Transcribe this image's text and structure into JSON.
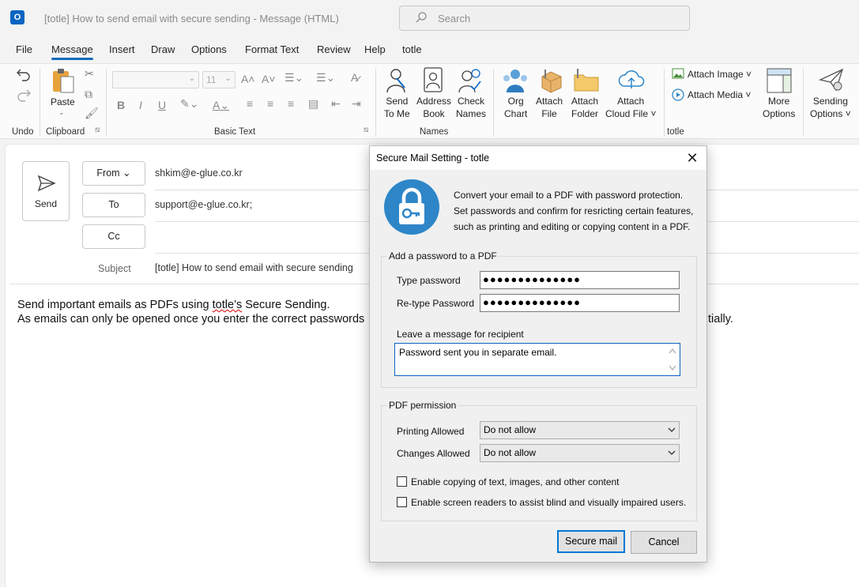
{
  "window": {
    "app_icon_letter": "O",
    "title": "[totle] How to send email with secure sending  -  Message (HTML)",
    "search_placeholder": "Search"
  },
  "menu": {
    "tabs": [
      "File",
      "Message",
      "Insert",
      "Draw",
      "Options",
      "Format Text",
      "Review",
      "Help",
      "totle"
    ],
    "active": "Message"
  },
  "ribbon": {
    "groups": {
      "undo": "Undo",
      "clipboard": "Clipboard",
      "basic_text": "Basic Text",
      "names": "Names",
      "totle": "totle"
    },
    "paste_label": "Paste",
    "font_size": "11",
    "names_buttons": [
      {
        "line1": "Send",
        "line2": "To Me"
      },
      {
        "line1": "Address",
        "line2": "Book"
      },
      {
        "line1": "Check",
        "line2": "Names"
      }
    ],
    "totle_buttons": [
      {
        "line1": "Org",
        "line2": "Chart"
      },
      {
        "line1": "Attach",
        "line2": "File"
      },
      {
        "line1": "Attach",
        "line2": "Folder"
      },
      {
        "line1": "Attach",
        "line2": "Cloud File ˅"
      }
    ],
    "attach_image": "Attach Image ˅",
    "attach_media": "Attach Media ˅",
    "more_options": {
      "line1": "More",
      "line2": "Options"
    },
    "sending_options": {
      "line1": "Sending",
      "line2": "Options ˅"
    }
  },
  "compose": {
    "send_label": "Send",
    "from_label": "From",
    "from_value": "shkim@e-glue.co.kr",
    "to_label": "To",
    "to_value": "support@e-glue.co.kr;",
    "cc_label": "Cc",
    "subject_label": "Subject",
    "subject_value": "[totle] How to send email with secure sending",
    "body_line1_a": "Send important emails as PDFs using ",
    "body_line1_b": "totle’s",
    "body_line1_c": " Secure Sending.",
    "body_line2_left": "As emails can only be opened once you enter the correct passwords",
    "body_line2_right": "tially."
  },
  "dialog": {
    "title": "Secure Mail Setting - totle",
    "intro": "Convert your email to a PDF with password protection. Set passwords and confirm for resricting certain features, such as printing and editing or copying content in a PDF.",
    "password_group_title": "Add a password to a PDF",
    "type_password_label": "Type password",
    "type_password_value": "●●●●●●●●●●●●●●",
    "retype_password_label": "Re-type Password",
    "retype_password_value": "●●●●●●●●●●●●●●",
    "message_label": "Leave a message for recipient",
    "message_value": "Password sent you in separate email.",
    "permission_group_title": "PDF permission",
    "printing_label": "Printing Allowed",
    "printing_value": "Do not allow",
    "changes_label": "Changes Allowed",
    "changes_value": "Do not allow",
    "copy_checkbox_label": "Enable copying of text, images, and other content",
    "copy_checked": false,
    "reader_checkbox_label": "Enable screen readers to assist blind and visually impaired users.",
    "reader_checked": false,
    "secure_button": "Secure mail",
    "cancel_button": "Cancel"
  },
  "colors": {
    "accent": "#0f6cbd",
    "lock_blue": "#2e86c8",
    "outlook_blue": "#0a64c2"
  }
}
